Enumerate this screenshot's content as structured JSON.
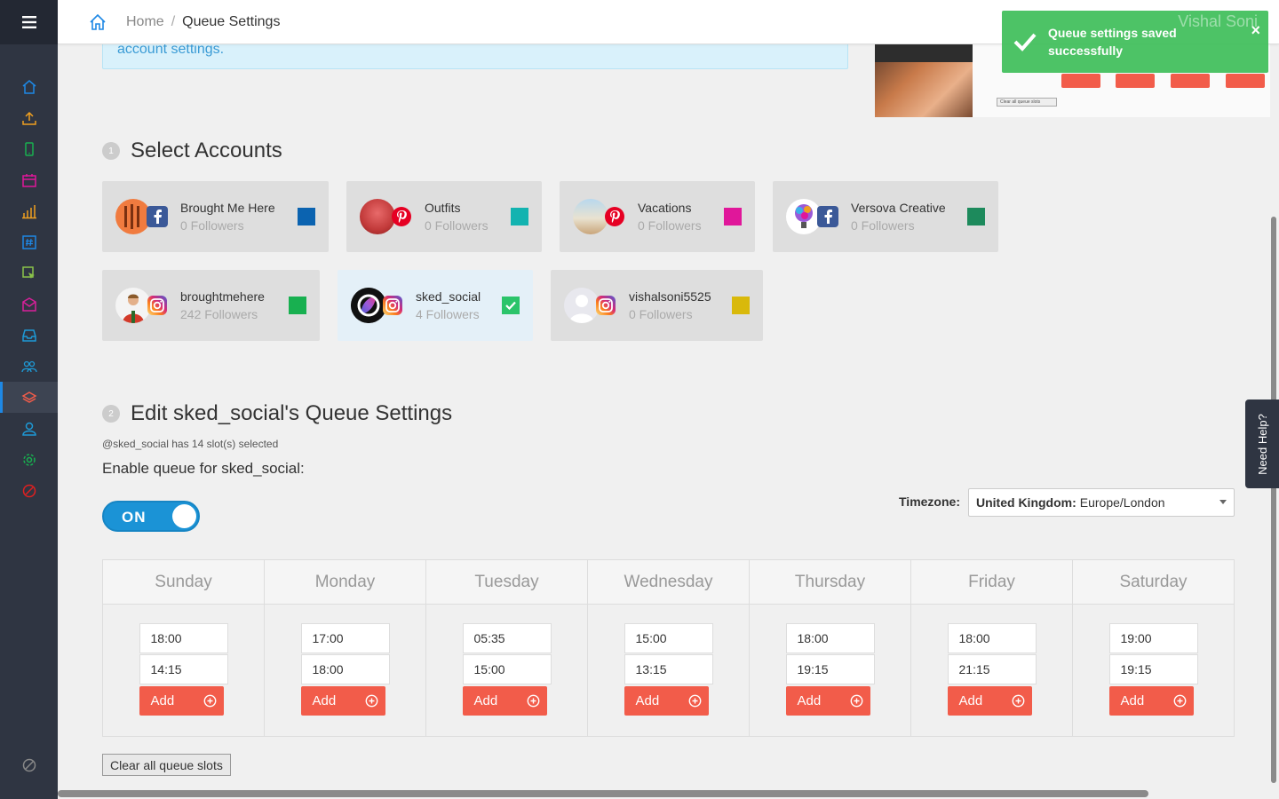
{
  "header": {
    "breadcrumb_home": "Home",
    "breadcrumb_separator": "/",
    "breadcrumb_current": "Queue Settings"
  },
  "banner": {
    "text": "account settings."
  },
  "preview": {
    "clear_text": "Clear all queue slots"
  },
  "toast": {
    "message": "Queue settings saved successfully",
    "close": "×",
    "user_name": "Vishal Soni"
  },
  "select_accounts": {
    "step": "1",
    "title": "Select Accounts",
    "accounts": [
      {
        "name": "Brought Me Here",
        "followers": "0 Followers",
        "network": "facebook",
        "color": "#0b63b0",
        "selected": false
      },
      {
        "name": "Outfits",
        "followers": "0 Followers",
        "network": "pinterest",
        "color": "#13b3b0",
        "selected": false
      },
      {
        "name": "Vacations",
        "followers": "0 Followers",
        "network": "pinterest",
        "color": "#e0179a",
        "selected": false
      },
      {
        "name": "Versova Creative",
        "followers": "0 Followers",
        "network": "facebook",
        "color": "#1d8a5c",
        "selected": false
      },
      {
        "name": "broughtmehere",
        "followers": "242 Followers",
        "network": "instagram",
        "color": "#18b050",
        "selected": false
      },
      {
        "name": "sked_social",
        "followers": "4 Followers",
        "network": "instagram",
        "color": "#2bc46a",
        "selected": true
      },
      {
        "name": "vishalsoni5525",
        "followers": "0 Followers",
        "network": "instagram",
        "color": "#d9b90b",
        "selected": false
      }
    ]
  },
  "queue_settings": {
    "step": "2",
    "title": "Edit sked_social's Queue Settings",
    "slot_note": "@sked_social has 14 slot(s) selected",
    "enable_label": "Enable queue for sked_social:",
    "toggle_label": "ON",
    "timezone_label": "Timezone:",
    "timezone_region": "United Kingdom:",
    "timezone_value": "Europe/London",
    "add_label": "Add",
    "clear_label": "Clear all queue slots",
    "days": [
      {
        "name": "Sunday",
        "slots": [
          "18:00",
          "14:15"
        ]
      },
      {
        "name": "Monday",
        "slots": [
          "17:00",
          "18:00"
        ]
      },
      {
        "name": "Tuesday",
        "slots": [
          "05:35",
          "15:00"
        ]
      },
      {
        "name": "Wednesday",
        "slots": [
          "15:00",
          "13:15"
        ]
      },
      {
        "name": "Thursday",
        "slots": [
          "18:00",
          "19:15"
        ]
      },
      {
        "name": "Friday",
        "slots": [
          "18:00",
          "21:15"
        ]
      },
      {
        "name": "Saturday",
        "slots": [
          "19:00",
          "19:15"
        ]
      }
    ]
  },
  "need_help": "Need Help?",
  "colors": {
    "accent": "#1b93d6",
    "add_button": "#f25c4a",
    "toast": "#40be5a",
    "sidebar": "#2f3542"
  }
}
